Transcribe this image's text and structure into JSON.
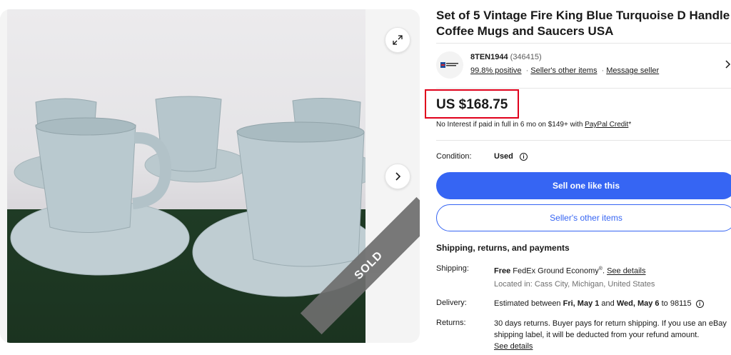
{
  "gallery": {
    "ribbon": "SOLD",
    "image_alt": "Blue turquoise mugs on saucers"
  },
  "listing": {
    "title": "Set of 5 Vintage Fire King Blue Turquoise D Handle Coffee Mugs and Saucers USA"
  },
  "seller": {
    "name": "8TEN1944",
    "feedback_count": "(346415)",
    "positive": "99.8% positive",
    "other_items": "Seller's other items",
    "message": "Message seller",
    "separator": "·"
  },
  "price": {
    "amount": "US $168.75",
    "financing_prefix": "No Interest if paid in full in 6 mo on $149+ with ",
    "financing_link": "PayPal Credit",
    "financing_suffix": "*"
  },
  "condition": {
    "label": "Condition:",
    "value": "Used"
  },
  "buttons": {
    "sell": "Sell one like this",
    "other_items": "Seller's other items"
  },
  "shipping": {
    "heading": "Shipping, returns, and payments",
    "shipping_label": "Shipping:",
    "free": "Free",
    "service": " FedEx Ground Economy",
    "reg": "®",
    "dot": ". ",
    "see_details": "See details",
    "location": "Located in: Cass City, Michigan, United States",
    "delivery_label": "Delivery:",
    "delivery_prefix": "Estimated between ",
    "delivery_start": "Fri, May 1",
    "delivery_and": " and ",
    "delivery_end": "Wed, May 6",
    "delivery_suffix": " to 98115",
    "returns_label": "Returns:",
    "returns_text": "30 days returns. Buyer pays for return shipping. If you use an eBay shipping label, it will be deducted from your refund amount.",
    "returns_link": "See details"
  },
  "colors": {
    "accent": "#3665f3",
    "price_highlight": "#e0001b"
  }
}
